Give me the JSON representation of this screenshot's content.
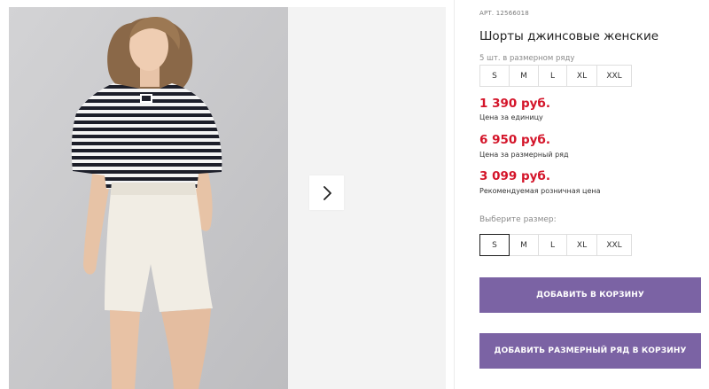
{
  "product": {
    "article": "АРТ. 12566018",
    "title": "Шорты джинсовые женские",
    "size_set_label": "5 шт. в размерном ряду",
    "sizes_in_set": [
      "S",
      "M",
      "L",
      "XL",
      "XXL"
    ],
    "prices": [
      {
        "amount": "1 390 руб.",
        "caption": "Цена за единицу"
      },
      {
        "amount": "6 950 руб.",
        "caption": "Цена за размерный ряд"
      },
      {
        "amount": "3 099 руб.",
        "caption": "Рекомендуемая розничная цена"
      }
    ],
    "choose_size_label": "Выберите размер:",
    "size_options": [
      "S",
      "M",
      "L",
      "XL",
      "XXL"
    ],
    "selected_size": "S"
  },
  "buttons": {
    "add_to_cart": "ДОБАВИТЬ В КОРЗИНУ",
    "add_size_row": "ДОБАВИТЬ РАЗМЕРНЫЙ РЯД В КОРЗИНУ"
  },
  "gallery": {
    "next_icon": "chevron-right-icon"
  },
  "colors": {
    "price": "#d4152a",
    "button": "#7b63a4",
    "photo_bg": "#c9c9cb"
  }
}
